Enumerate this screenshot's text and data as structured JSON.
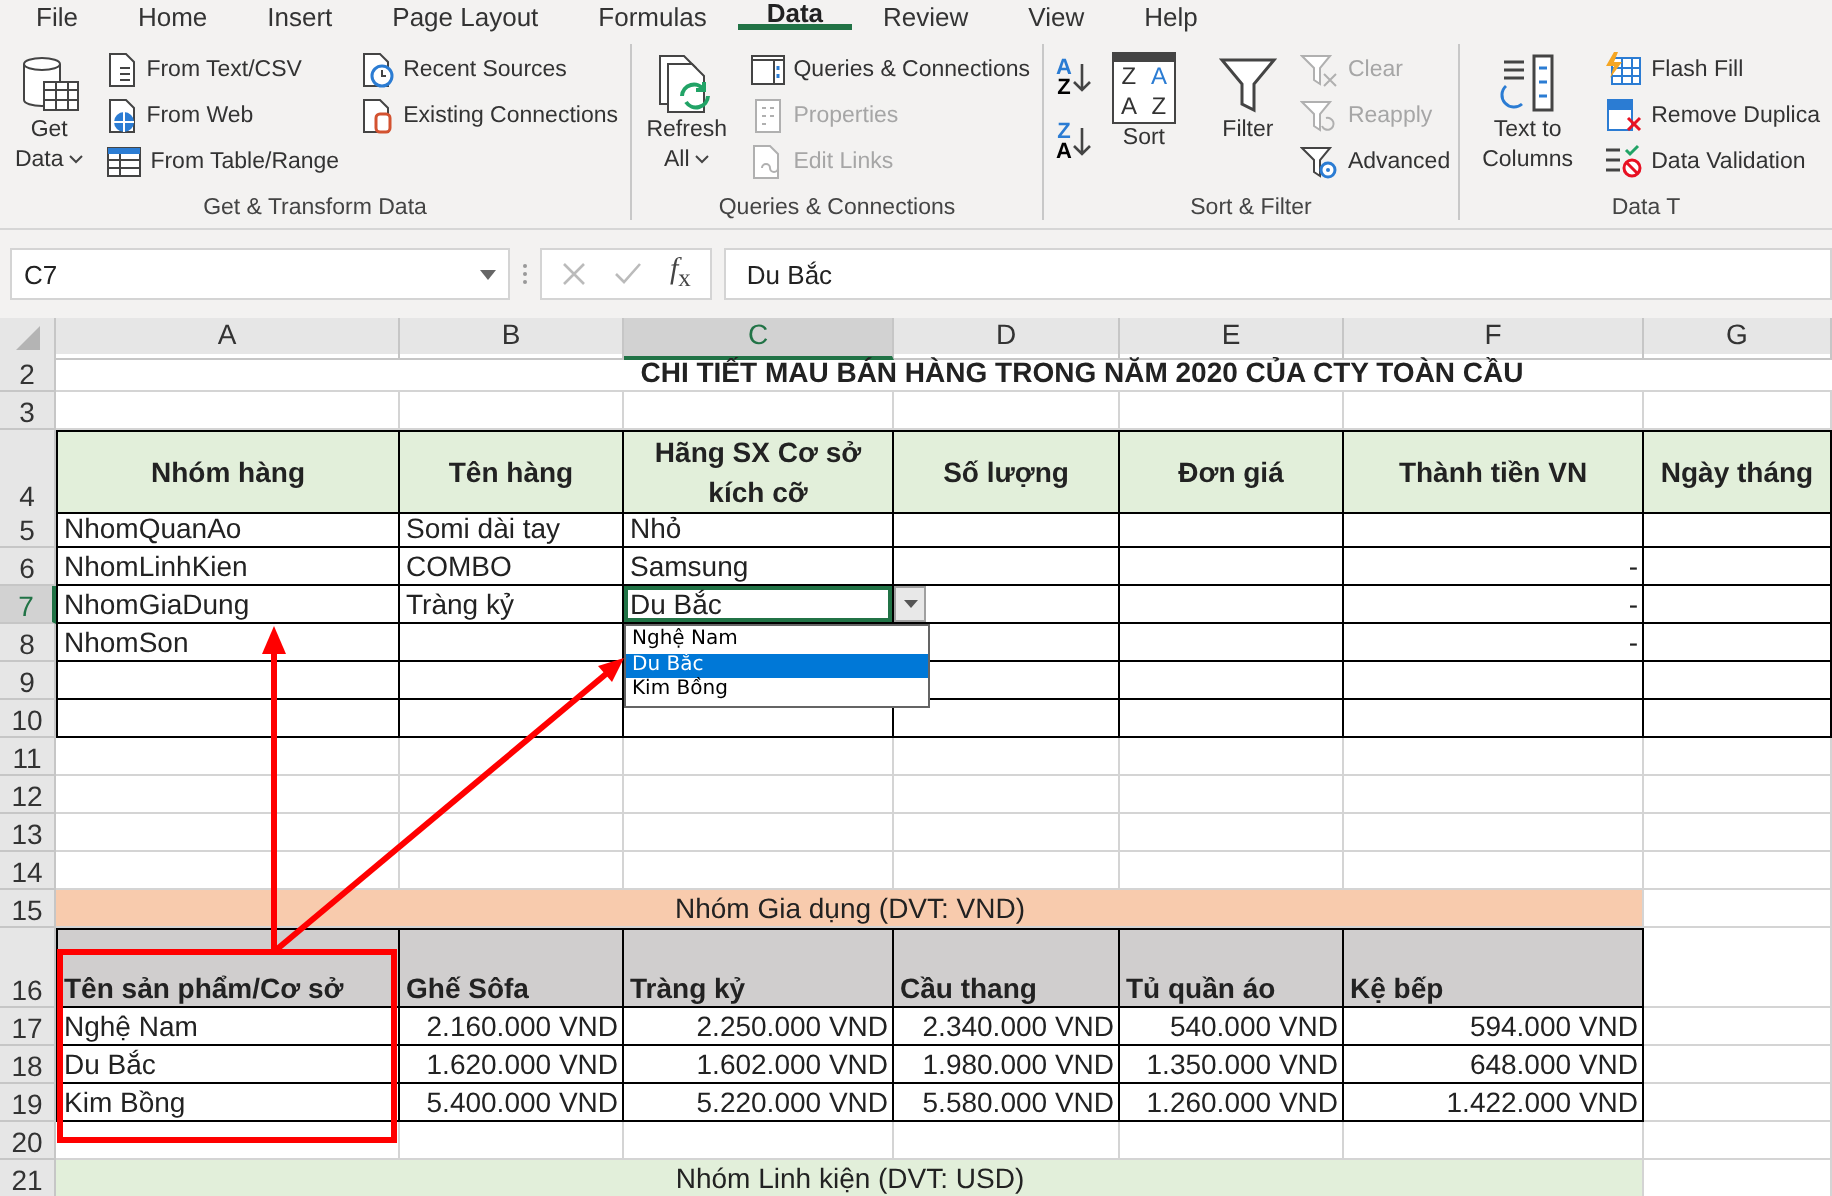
{
  "ribbon_tabs": [
    {
      "label": "File",
      "selected": false
    },
    {
      "label": "Home",
      "selected": false
    },
    {
      "label": "Insert",
      "selected": false
    },
    {
      "label": "Page Layout",
      "selected": false
    },
    {
      "label": "Formulas",
      "selected": false
    },
    {
      "label": "Data",
      "selected": true
    },
    {
      "label": "Review",
      "selected": false
    },
    {
      "label": "View",
      "selected": false
    },
    {
      "label": "Help",
      "selected": false
    }
  ],
  "ribbon_groups": [
    {
      "label": "Get & Transform Data",
      "commands": [
        {
          "kind": "large",
          "label": "Get Data",
          "menu": true,
          "disabled": false
        },
        {
          "kind": "small",
          "label": "From Text/CSV",
          "disabled": false
        },
        {
          "kind": "small",
          "label": "From Web",
          "disabled": false
        },
        {
          "kind": "small",
          "label": "From Table/Range",
          "disabled": false
        },
        {
          "kind": "small",
          "label": "Recent Sources",
          "disabled": false
        },
        {
          "kind": "small",
          "label": "Existing Connections",
          "disabled": false
        }
      ]
    },
    {
      "label": "Queries & Connections",
      "commands": [
        {
          "kind": "large",
          "label": "Refresh All",
          "menu": true,
          "disabled": false
        },
        {
          "kind": "small",
          "label": "Queries & Connections",
          "disabled": false
        },
        {
          "kind": "small",
          "label": "Properties",
          "disabled": true
        },
        {
          "kind": "small",
          "label": "Edit Links",
          "disabled": true
        }
      ]
    },
    {
      "label": "Sort & Filter",
      "commands": [
        {
          "kind": "sort",
          "glyphs": [
            "A",
            "Z"
          ],
          "disabled": false
        },
        {
          "kind": "sort",
          "glyphs": [
            "Z",
            "A"
          ],
          "disabled": false
        },
        {
          "kind": "large",
          "label": "Sort",
          "glyphs": [
            "Z",
            "A",
            "A",
            "Z"
          ],
          "disabled": false
        },
        {
          "kind": "large",
          "label": "Filter",
          "disabled": false
        },
        {
          "kind": "small",
          "label": "Clear",
          "disabled": true
        },
        {
          "kind": "small",
          "label": "Reapply",
          "disabled": true
        },
        {
          "kind": "small",
          "label": "Advanced",
          "disabled": false
        }
      ]
    },
    {
      "label": "Data T",
      "commands": [
        {
          "kind": "large",
          "label": "Text to Columns",
          "disabled": false
        },
        {
          "kind": "small",
          "label": "Flash Fill",
          "disabled": false
        },
        {
          "kind": "small",
          "label": "Remove Duplica",
          "disabled": false
        },
        {
          "kind": "small",
          "label": "Data Validation",
          "disabled": false
        }
      ]
    }
  ],
  "name_box": "C7",
  "formula_function": "*f*$_{x}$",
  "formula": "Du Bắc",
  "columns": [
    {
      "label": "A",
      "selected": false
    },
    {
      "label": "B",
      "selected": false
    },
    {
      "label": "C",
      "selected": true
    },
    {
      "label": "D",
      "selected": false
    },
    {
      "label": "E",
      "selected": false
    },
    {
      "label": "F",
      "selected": false
    },
    {
      "label": "G",
      "selected": false
    }
  ],
  "rows": [
    {
      "number": "2",
      "kind": "title",
      "selected": false,
      "text": "CHI TIẾT MAU BÁN HÀNG TRONG NĂM 2020 CỦA CTY TOÀN CẦU"
    },
    {
      "number": "3",
      "kind": "blank",
      "selected": false
    },
    {
      "number": "4",
      "kind": "table_header",
      "selected": false,
      "cells": {
        "A": "Nhóm hàng",
        "B": "Tên hàng",
        "C": "Hãng SX Cơ sở kích cỡ",
        "D": "Số lượng",
        "E": "Đơn giá",
        "F": "Thành tiền VN",
        "G": "Ngày tháng"
      }
    },
    {
      "number": "5",
      "kind": "table_row",
      "selected": false,
      "cells": {
        "A": "NhomQuanAo",
        "B": "Somi dài tay",
        "C": "Nhỏ"
      }
    },
    {
      "number": "6",
      "kind": "table_row",
      "selected": false,
      "cells": {
        "A": "NhomLinhKien",
        "B": "COMBO",
        "C": "Samsung",
        "F": "-"
      }
    },
    {
      "number": "7",
      "kind": "table_row",
      "selected": true,
      "cells": {
        "A": "NhomGiaDung",
        "B": "Tràng kỷ",
        "C": "Du Bắc",
        "F": "-"
      }
    },
    {
      "number": "8",
      "kind": "table_row",
      "selected": false,
      "cells": {
        "A": "NhomSon",
        "F": "-"
      }
    },
    {
      "number": "9",
      "kind": "table_row",
      "selected": false
    },
    {
      "number": "10",
      "kind": "table_row",
      "selected": false
    },
    {
      "number": "11",
      "kind": "blank",
      "selected": false
    },
    {
      "number": "12",
      "kind": "blank",
      "selected": false
    },
    {
      "number": "13",
      "kind": "blank",
      "selected": false
    },
    {
      "number": "14",
      "kind": "blank",
      "selected": false
    },
    {
      "number": "15",
      "kind": "band",
      "selected": false,
      "text": "Nhóm Gia dụng (DVT: VND)",
      "color": "#f8cbad"
    },
    {
      "number": "16",
      "kind": "price_header",
      "selected": false,
      "cells": {
        "A": "Tên sản phẩm/Cơ sở",
        "B": "Ghế Sôfa",
        "C": "Tràng kỷ",
        "D": "Cầu thang",
        "E": "Tủ quần áo",
        "F": "Kệ bếp"
      }
    },
    {
      "number": "17",
      "kind": "price_row",
      "selected": false,
      "cells": {
        "A": "Nghệ Nam",
        "B": "2.160.000 VND",
        "C": "2.250.000 VND",
        "D": "2.340.000 VND",
        "E": "540.000 VND",
        "F": "594.000 VND"
      }
    },
    {
      "number": "18",
      "kind": "price_row",
      "selected": false,
      "cells": {
        "A": "Du Bắc",
        "B": "1.620.000 VND",
        "C": "1.602.000 VND",
        "D": "1.980.000 VND",
        "E": "1.350.000 VND",
        "F": "648.000 VND"
      }
    },
    {
      "number": "19",
      "kind": "price_row",
      "selected": false,
      "cells": {
        "A": "Kim Bồng",
        "B": "5.400.000 VND",
        "C": "5.220.000 VND",
        "D": "5.580.000 VND",
        "E": "1.260.000 VND",
        "F": "1.422.000 VND"
      }
    },
    {
      "number": "20",
      "kind": "blank",
      "selected": false
    },
    {
      "number": "21",
      "kind": "band",
      "selected": false,
      "text": "Nhóm Linh kiện (DVT: USD)",
      "color": "#e2efda"
    }
  ],
  "cell_dropdown": {
    "options": [
      {
        "label": "Nghệ Nam",
        "selected": false
      },
      {
        "label": "Du Bắc",
        "selected": true
      },
      {
        "label": "Kim Bồng",
        "selected": false
      }
    ]
  }
}
